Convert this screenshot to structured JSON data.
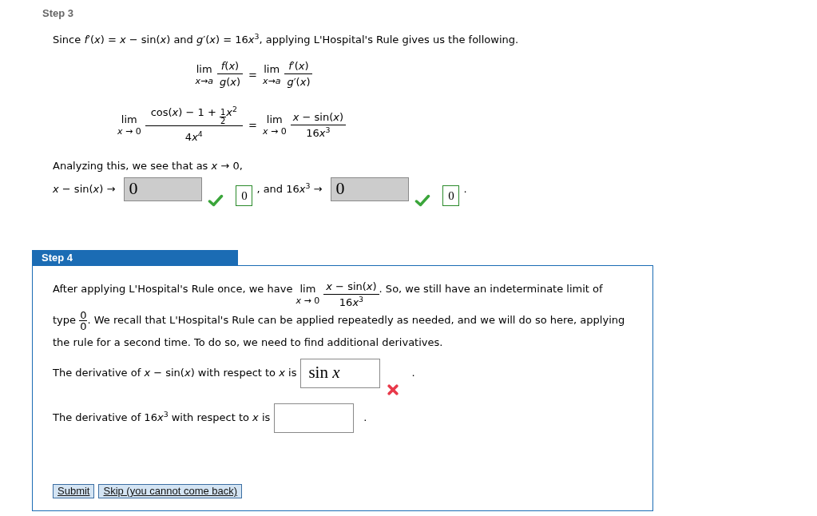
{
  "steps": [
    {
      "title": "Step 3",
      "current": false,
      "blocks": [
        {
          "kind": "paragraph",
          "pieces": [
            {
              "kind": "text",
              "text": "Since *f*′(*x*) = *x* − sin(*x*) and *g*′(*x*) = 16"
            },
            {
              "kind": "text",
              "text": "*x*$^{3}$, applying L'Hospital's Rule gives us the following."
            }
          ]
        },
        {
          "kind": "equations",
          "rows": [
            {
              "left": {
                "operator": "lim",
                "under": "*x*→*a*",
                "numerator": "*f*(*x*)",
                "denominator": "*g*(*x*)"
              },
              "relation": "=",
              "right": {
                "operator": "lim",
                "under": "*x*→*a*",
                "numerator": "*f*′(*x*)",
                "denominator": "*g*′(*x*)"
              }
            },
            {
              "left": {
                "operator": "lim",
                "under": "*x* → 0",
                "numerator": [
                  "cos(*x*) − 1 + ",
                  {
                    "kind": "fraction",
                    "numerator": "1",
                    "denominator": "2"
                  },
                  "*x*$^{2}$"
                ],
                "denominator": [
                  "4",
                  "*x*$^{4}$"
                ]
              },
              "relation": "=",
              "right": {
                "operator": "lim",
                "under": "*x* → 0",
                "numerator": "*x* − sin(*x*)",
                "denominator": [
                  "16",
                  "*x*$^{3}$"
                ]
              }
            }
          ]
        },
        {
          "kind": "paragraph",
          "pieces": [
            {
              "kind": "text",
              "text": "Analyzing this, we see that as *x* → 0,"
            }
          ]
        },
        {
          "kind": "answer_line",
          "pieces": [
            {
              "kind": "text",
              "text": "*x* − sin(*x*) →"
            },
            {
              "kind": "answer",
              "value": "0",
              "disabled": true,
              "correct": true,
              "key": "0"
            },
            {
              "kind": "text",
              "text": [
                ", and 16",
                "*x*$^{3}$ →"
              ]
            },
            {
              "kind": "answer",
              "value": "0",
              "disabled": true,
              "correct": true,
              "key": "0"
            },
            {
              "kind": "text",
              "text": "."
            }
          ]
        }
      ]
    },
    {
      "title": "Step 4",
      "current": true,
      "blocks": [
        {
          "kind": "paragraph",
          "pieces": [
            {
              "kind": "text",
              "text": "After applying L'Hospital's Rule once, we have "
            },
            {
              "kind": "limit",
              "operator": "lim",
              "under": "*x* → 0",
              "numerator": "*x* − sin(*x*)",
              "denominator": [
                "16",
                "*x*$^{3}$"
              ]
            },
            {
              "kind": "text",
              "text": ". So, we still have an indeterminate limit of type "
            },
            {
              "kind": "fraction",
              "numerator": "0",
              "denominator": "0"
            },
            {
              "kind": "text",
              "text": ". We recall that L'Hospital's Rule can be applied repeatedly as needed, and we will do so here, applying the rule for a second time. To do so, we need to find additional derivatives."
            }
          ]
        },
        {
          "kind": "answer_line",
          "pieces": [
            {
              "kind": "text",
              "text": "The derivative of *x* − sin(*x*) with respect to *x* is"
            },
            {
              "kind": "answer",
              "value": "sin *x*",
              "disabled": false,
              "correct": false
            },
            {
              "kind": "text",
              "text": "."
            }
          ]
        },
        {
          "kind": "answer_line",
          "pieces": [
            {
              "kind": "text",
              "text": [
                "The derivative of 16",
                "*x*$^{3}$ with respect to *x* is"
              ]
            },
            {
              "kind": "answer",
              "disabled": false
            },
            {
              "kind": "text",
              "text": "."
            }
          ]
        },
        {
          "kind": "buttons",
          "buttons": [
            "Submit",
            "Skip (you cannot come back)"
          ]
        }
      ]
    }
  ]
}
